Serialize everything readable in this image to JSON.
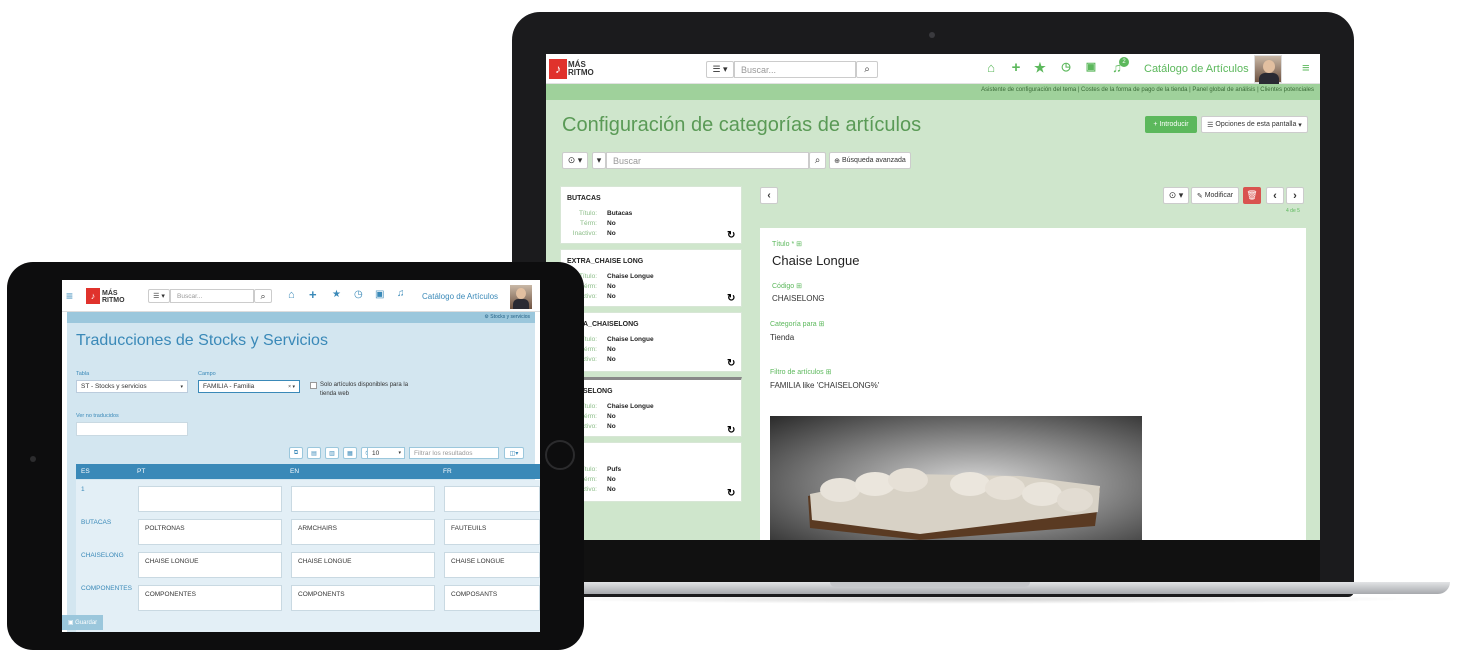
{
  "laptop": {
    "logo_line1": "MÁS",
    "logo_line2": "RITMO",
    "search_placeholder": "Buscar...",
    "header_title": "Catálogo de Artículos",
    "notif_count": "2",
    "links_bar": "Asistente de configuración del tema  |  Costes de la forma de pago de la tienda  |  Panel global de análisis  |  Clientes potenciales",
    "page_title": "Configuración de categorías de artículos",
    "btn_introducir": "+ Introducir",
    "btn_opciones": "Opciones de esta pantalla",
    "filter_placeholder": "Buscar",
    "btn_busqueda": "Búsqueda avanzada",
    "btn_modificar": "Modificar",
    "pager": "4 de 5",
    "list": [
      {
        "code": "BUTACAS",
        "titulo": "Butacas",
        "term": "No",
        "inactivo": "No"
      },
      {
        "code": "EXTRA_CHAISE LONG",
        "titulo": "Chaise Longue",
        "term": "No",
        "inactivo": "No"
      },
      {
        "code": "A_CHAISELONG",
        "titulo": "Chaise Longue",
        "term": "No",
        "inactivo": "No"
      },
      {
        "code": "SELONG",
        "titulo": "Chaise Longue",
        "term": "No",
        "inactivo": "No"
      },
      {
        "code": "",
        "titulo": "Pufs",
        "term": "No",
        "inactivo": "No"
      }
    ],
    "labels": {
      "titulo": "Título:",
      "term": "Térm:",
      "inactivo": "Inactivo:"
    },
    "detail": {
      "titulo_label": "Título *",
      "titulo_value": "Chaise Longue",
      "codigo_label": "Código",
      "codigo_value": "CHAISELONG",
      "categoria_label": "Categoría para",
      "categoria_value": "Tienda",
      "filtro_label": "Filtro de artículos",
      "filtro_value": "FAMILIA like 'CHAISELONG%'"
    }
  },
  "tablet": {
    "logo_line1": "MÁS",
    "logo_line2": "RITMO",
    "search_placeholder": "Buscar...",
    "header_title": "Catálogo de Artículos",
    "breadcrumb": "Stocks y servicios",
    "page_title": "Traducciones de Stocks y Servicios",
    "tabla_label": "Tabla",
    "tabla_value": "ST - Stocks y servicios",
    "campo_label": "Campo",
    "campo_value": "FAMILIA - Familia",
    "checkbox_label": "Solo artículos disponibles para la tienda web",
    "ver_label": "Ver no traducidos",
    "page_size": "10",
    "filter_placeholder": "Filtrar los resultados",
    "columns": [
      "ES",
      "PT",
      "EN",
      "FR"
    ],
    "rows": [
      {
        "key": "1",
        "pt": "",
        "en": "",
        "fr": ""
      },
      {
        "key": "BUTACAS",
        "pt": "POLTRONAS",
        "en": "ARMCHAIRS",
        "fr": "FAUTEUILS"
      },
      {
        "key": "CHAISELONG",
        "pt": "CHAISE LONGUE",
        "en": "CHAISE LONGUE",
        "fr": "CHAISE LONGUE"
      },
      {
        "key": "COMPONENTES",
        "pt": "COMPONENTES",
        "en": "COMPONENTS",
        "fr": "COMPOSANTS"
      }
    ],
    "save_label": "Guardar"
  },
  "colors": {
    "brand_red": "#e0322c",
    "laptop_green": "#5cb85c",
    "tablet_blue": "#3a89b8"
  }
}
